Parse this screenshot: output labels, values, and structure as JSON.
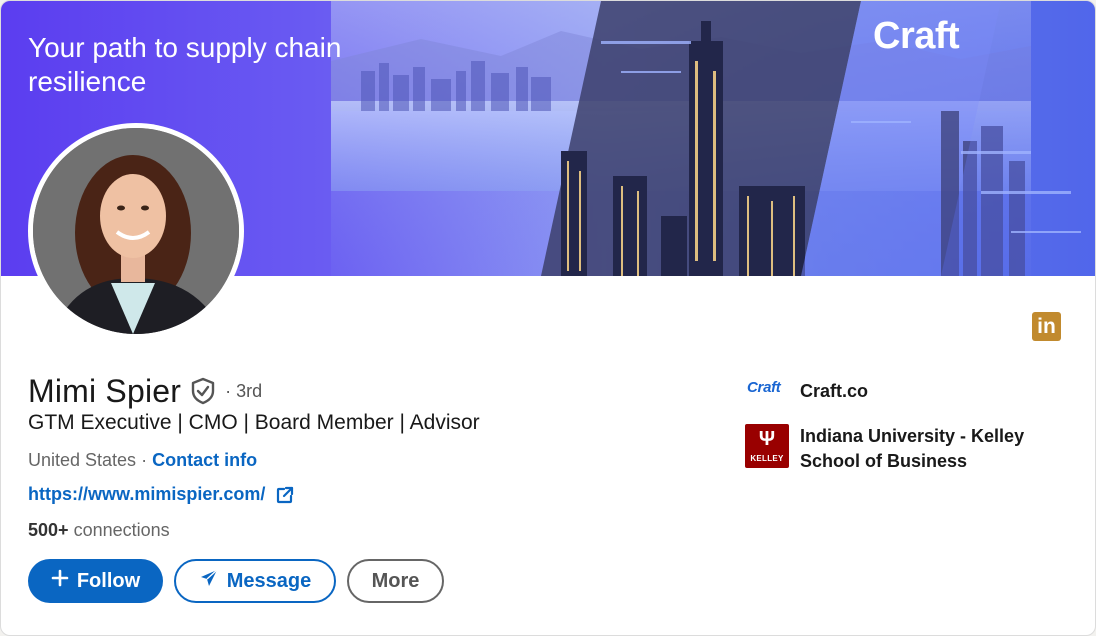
{
  "banner": {
    "tagline": "Your path to supply chain resilience",
    "brand": "Craft"
  },
  "profile": {
    "name": "Mimi Spier",
    "degree": "· 3rd",
    "headline": "GTM Executive | CMO | Board Member | Advisor",
    "location": "United States",
    "location_separator": "·",
    "contact_label": "Contact info",
    "website": "https://www.mimispier.com/",
    "connections_count": "500+",
    "connections_label": "connections"
  },
  "actions": {
    "follow": "Follow",
    "message": "Message",
    "more": "More"
  },
  "sidebar": {
    "company": {
      "logo_text": "Craft",
      "name": "Craft.co"
    },
    "school": {
      "logo_mark": "Ψ",
      "logo_word": "KELLEY",
      "name_line1": "Indiana University - Kelley",
      "name_line2": "School of Business"
    }
  },
  "icons": {
    "linkedin": "in",
    "verified": "shield-check-icon",
    "external_link": "external-link-icon",
    "plus": "+",
    "send": "paper-plane-icon"
  },
  "colors": {
    "primary": "#0a66c2",
    "banner_start": "#5b3df0",
    "linkedin_badge": "#c18a2e",
    "iu_crimson": "#990000"
  }
}
